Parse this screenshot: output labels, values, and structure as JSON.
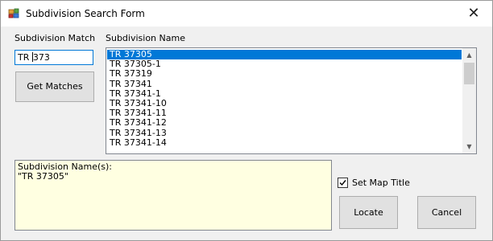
{
  "window": {
    "title": "Subdivision Search Form"
  },
  "labels": {
    "subdivision_match": "Subdivision Match",
    "subdivision_name": "Subdivision Name"
  },
  "match_input": {
    "value": "TR 373"
  },
  "buttons": {
    "get_matches": "Get Matches",
    "locate": "Locate",
    "cancel": "Cancel"
  },
  "list": {
    "items": [
      "TR 37305",
      "TR 37305-1",
      "TR 37319",
      "TR 37341",
      "TR 37341-1",
      "TR 37341-10",
      "TR 37341-11",
      "TR 37341-12",
      "TR 37341-13",
      "TR 37341-14"
    ],
    "selected_index": 0
  },
  "result": {
    "line1": "Subdivision Name(s):",
    "line2": "\"TR 37305\""
  },
  "checkbox": {
    "label": "Set Map Title",
    "checked": true
  },
  "colors": {
    "selection": "#0078d7",
    "result_bg": "#ffffe1"
  }
}
